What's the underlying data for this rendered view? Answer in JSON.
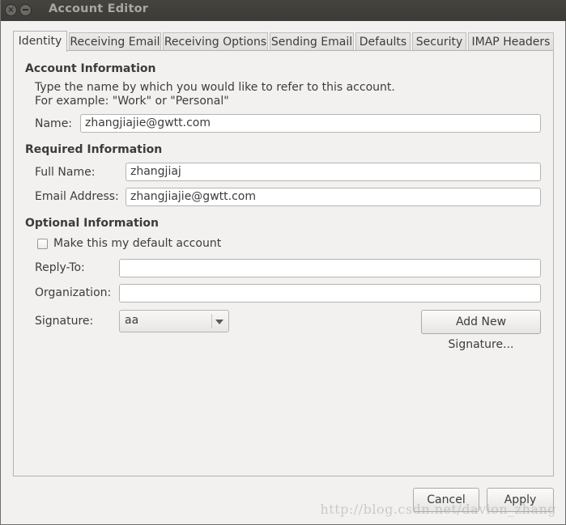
{
  "window": {
    "title": "Account Editor",
    "close_icon": "close-icon",
    "minimize_icon": "minimize-icon"
  },
  "tabs": [
    {
      "label": "Identity",
      "active": true
    },
    {
      "label": "Receiving Email",
      "active": false
    },
    {
      "label": "Receiving Options",
      "active": false
    },
    {
      "label": "Sending Email",
      "active": false
    },
    {
      "label": "Defaults",
      "active": false
    },
    {
      "label": "Security",
      "active": false
    },
    {
      "label": "IMAP Headers",
      "active": false
    }
  ],
  "account_information": {
    "title": "Account Information",
    "description_line1": "Type the name by which you would like to refer to this account.",
    "description_line2": "For example: \"Work\" or \"Personal\"",
    "name_label": "Name:",
    "name_value": "zhangjiajie@gwtt.com"
  },
  "required_information": {
    "title": "Required Information",
    "full_name_label": "Full Name:",
    "full_name_value": "zhangjiaj",
    "email_label": "Email Address:",
    "email_value": "zhangjiajie@gwtt.com"
  },
  "optional_information": {
    "title": "Optional Information",
    "default_account_label": "Make this my default account",
    "default_account_checked": false,
    "reply_to_label": "Reply-To:",
    "reply_to_value": "",
    "organization_label": "Organization:",
    "organization_value": "",
    "signature_label": "Signature:",
    "signature_value": "aa",
    "add_signature_label": "Add New Signature..."
  },
  "footer": {
    "cancel_label": "Cancel",
    "apply_label": "Apply"
  },
  "watermark": "http://blog.csdn.net/davion_zhang"
}
